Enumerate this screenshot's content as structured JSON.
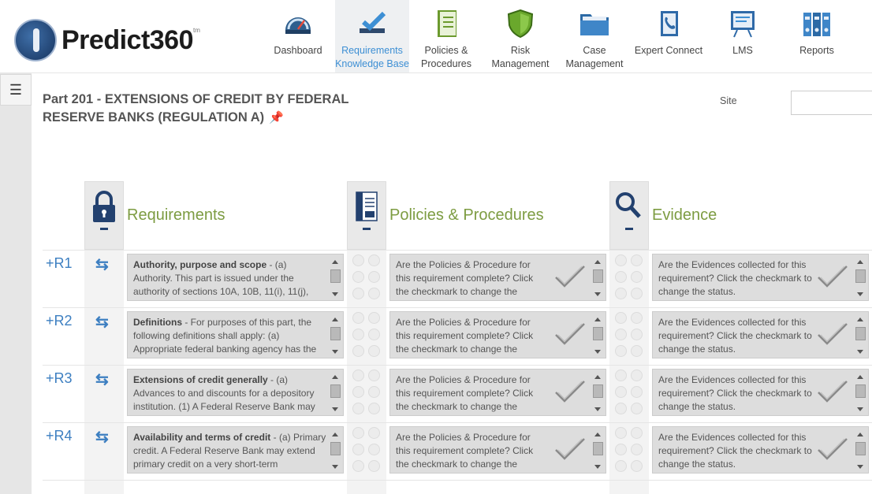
{
  "app": {
    "name": "Predict360",
    "tm": "tm"
  },
  "nav": [
    {
      "label": "Dashboard",
      "icon": "dashboard-gauge-icon"
    },
    {
      "label": "Requirements Knowledge Base",
      "icon": "checkmark-icon",
      "active": true
    },
    {
      "label": "Policies & Procedures",
      "icon": "policy-book-icon"
    },
    {
      "label": "Risk Management",
      "icon": "shield-icon"
    },
    {
      "label": "Case Management",
      "icon": "folder-icon"
    },
    {
      "label": "Expert Connect",
      "icon": "phone-icon"
    },
    {
      "label": "LMS",
      "icon": "presentation-board-icon"
    },
    {
      "label": "Reports",
      "icon": "binders-icon"
    }
  ],
  "page": {
    "title": "Part 201 - EXTENSIONS OF CREDIT BY FEDERAL RESERVE BANKS (REGULATION A)"
  },
  "site": {
    "label": "Site",
    "value": ""
  },
  "columns": {
    "requirements": "Requirements",
    "policies": "Policies & Procedures",
    "evidence": "Evidence"
  },
  "colors": {
    "accent": "#3d8fd4",
    "title_green": "#7d9c42",
    "navy": "#23416f"
  },
  "rows": [
    {
      "label": "+R1",
      "req_title": "Authority, purpose and scope",
      "req_text": " - (a) Authority. This part is issued under the authority of sections 10A, 10B, 11(i), 11(j),",
      "pp_text": "Are the Policies & Procedure for this requirement complete? Click the checkmark to change the",
      "ev_text": "Are the Evidences collected for this requirement? Click the checkmark to change the status."
    },
    {
      "label": "+R2",
      "req_title": "Definitions",
      "req_text": " - For purposes of this part, the following definitions shall apply: (a) Appropriate federal banking agency has the",
      "pp_text": "Are the Policies & Procedure for this requirement complete? Click the checkmark to change the",
      "ev_text": "Are the Evidences collected for this requirement? Click the checkmark to change the status."
    },
    {
      "label": "+R3",
      "req_title": "Extensions of credit generally",
      "req_text": " - (a) Advances to and discounts for a depository institution. (1) A Federal Reserve Bank may",
      "pp_text": "Are the Policies & Procedure for this requirement complete? Click the checkmark to change the",
      "ev_text": "Are the Evidences collected for this requirement? Click the checkmark to change the status."
    },
    {
      "label": "+R4",
      "req_title": "Availability and terms of credit",
      "req_text": " - (a) Primary credit. A Federal Reserve Bank may extend primary credit on a very short-term",
      "pp_text": "Are the Policies & Procedure for this requirement complete? Click the checkmark to change the",
      "ev_text": "Are the Evidences collected for this requirement? Click the checkmark to change the status."
    }
  ]
}
